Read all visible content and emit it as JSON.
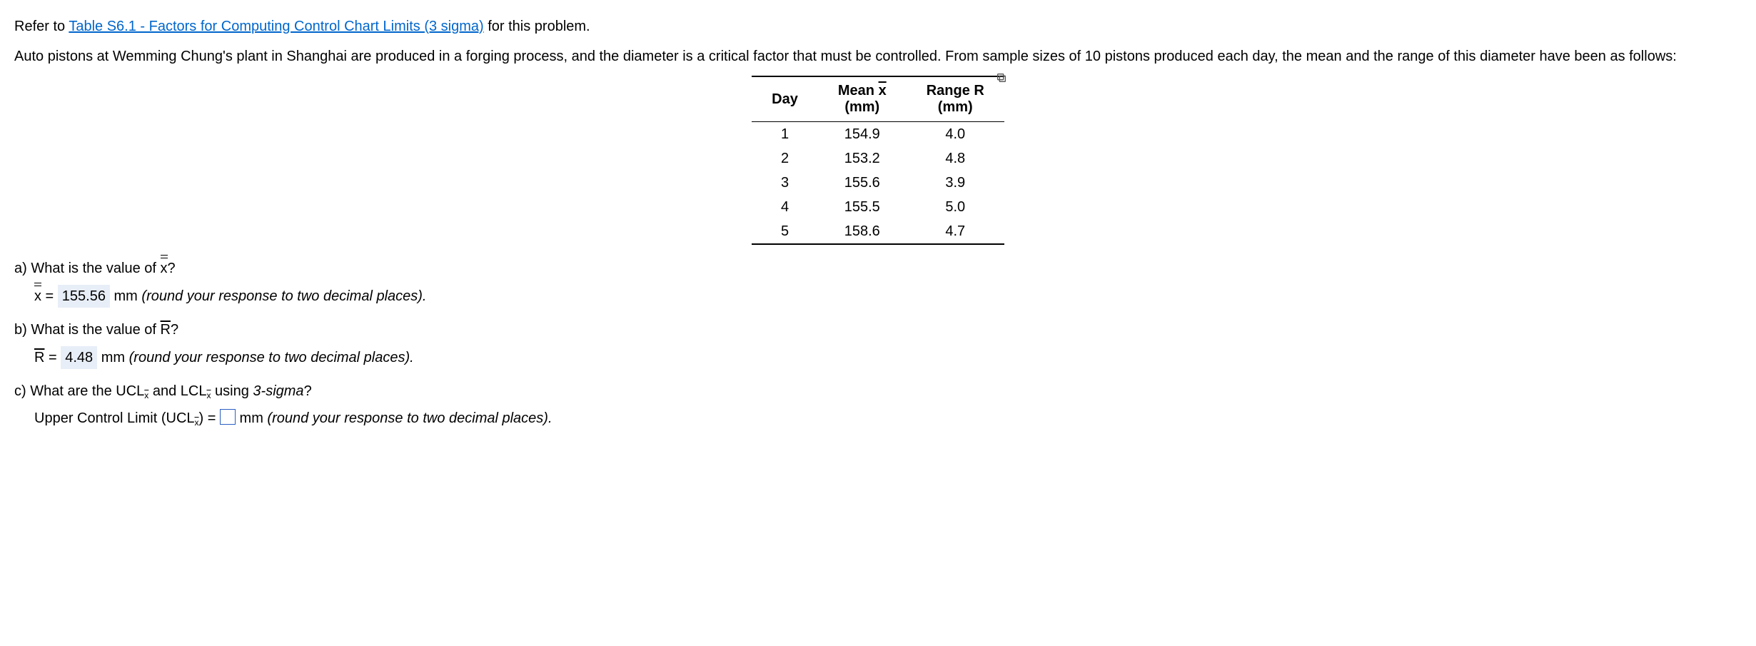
{
  "intro": {
    "prefix": "Refer to ",
    "link_text": "Table S6.1 - Factors for Computing Control Chart Limits (3 sigma)",
    "suffix": " for this problem."
  },
  "prompt": "Auto pistons at Wemming Chung's plant in Shanghai are produced in a forging process, and the diameter is a critical factor that must be controlled. From sample sizes of 10 pistons produced each day, the mean and the range of this diameter have been as follows:",
  "table": {
    "headers": {
      "day": "Day",
      "mean_top": "Mean ",
      "mean_unit": "(mm)",
      "range_top": "Range R",
      "range_unit": "(mm)"
    },
    "rows": [
      {
        "day": "1",
        "mean": "154.9",
        "range": "4.0"
      },
      {
        "day": "2",
        "mean": "153.2",
        "range": "4.8"
      },
      {
        "day": "3",
        "mean": "155.6",
        "range": "3.9"
      },
      {
        "day": "4",
        "mean": "155.5",
        "range": "5.0"
      },
      {
        "day": "5",
        "mean": "158.6",
        "range": "4.7"
      }
    ]
  },
  "qa": {
    "prefix": "a) What is the value of ",
    "var": "x",
    "suffix": "?"
  },
  "ansa": {
    "var": "x",
    "eq": " = ",
    "val": "155.56",
    "unit": " mm ",
    "hint": "(round your response to two decimal places)."
  },
  "qb": {
    "prefix": "b) What is the value of ",
    "var": "R",
    "suffix": "?"
  },
  "ansb": {
    "var": "R",
    "eq": " = ",
    "val": "4.48",
    "unit": " mm ",
    "hint": "(round your response to two decimal places)."
  },
  "qc": {
    "prefix": "c) What are the ",
    "ucl": "UCL",
    "and": " and ",
    "lcl": "LCL",
    "suffix_pre": " using ",
    "sigma": "3-sigma",
    "suffix_post": "?"
  },
  "ansc": {
    "label_pre": "Upper Control Limit (",
    "ucl": "UCL",
    "label_post": ") = ",
    "unit": " mm ",
    "hint": "(round your response to two decimal places)."
  }
}
